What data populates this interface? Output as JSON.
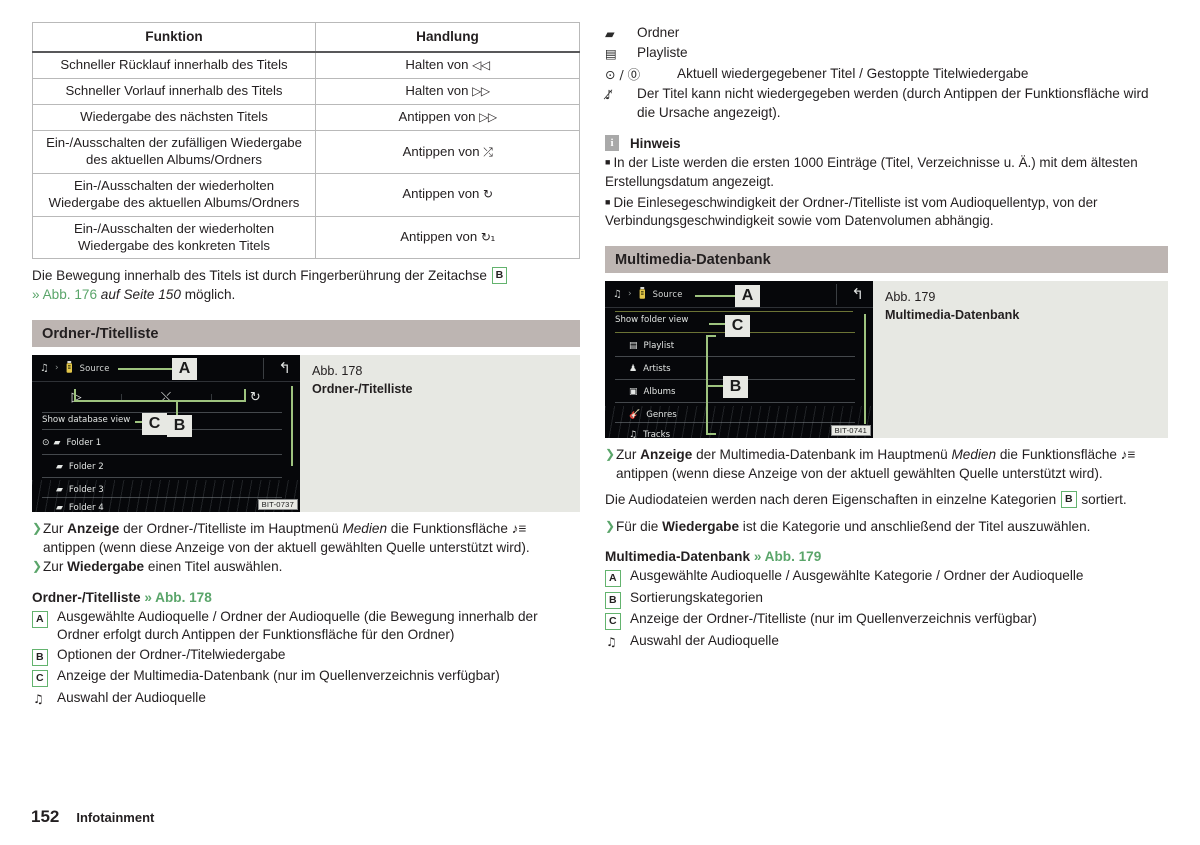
{
  "table": {
    "headers": [
      "Funktion",
      "Handlung"
    ],
    "rows": [
      {
        "function": "Schneller Rücklauf innerhalb des Titels",
        "action": "Halten von ",
        "icon": "◁◁"
      },
      {
        "function": "Schneller Vorlauf innerhalb des Titels",
        "action": "Halten von ",
        "icon": "▷▷"
      },
      {
        "function": "Wiedergabe des nächsten Titels",
        "action": "Antippen von ",
        "icon": "▷▷"
      },
      {
        "function": "Ein-/Ausschalten der zufälligen Wiedergabe des aktuellen Albums/Ordners",
        "action": "Antippen von ",
        "icon": "⤮"
      },
      {
        "function": "Ein-/Ausschalten der wiederholten Wiedergabe des aktuellen Albums/Ordners",
        "action": "Antippen von ",
        "icon": "↻"
      },
      {
        "function": "Ein-/Ausschalten der wiederholten Wiedergabe des konkreten Titels",
        "action": "Antippen von ",
        "icon": "↻₁"
      }
    ]
  },
  "intro_paragraph": {
    "line1": "Die Bewegung innerhalb des Titels ist durch Fingerberührung der Zeitachse ",
    "ref": "B",
    "link": "» Abb. 176",
    "italic": " auf Seite 150",
    "tail": " möglich."
  },
  "section_left": {
    "heading": "Ordner-/Titelliste",
    "figure": {
      "number": "Abb. 178",
      "title": "Ordner-/Titelliste",
      "bit_code": "BIT-0737",
      "screen": {
        "breadcrumb_note_icon": "♫",
        "breadcrumb_chevron": "›",
        "breadcrumb_source": "Source",
        "back_icon": "↰",
        "options": [
          "▷",
          "⤬",
          "↻"
        ],
        "db_link": "Show database view",
        "list": [
          {
            "playing": true,
            "icon": "folder",
            "label": "Folder 1"
          },
          {
            "playing": false,
            "icon": "folder",
            "label": "Folder 2"
          },
          {
            "playing": false,
            "icon": "folder",
            "label": "Folder 3"
          },
          {
            "playing": false,
            "icon": "folder",
            "label": "Folder 4"
          }
        ],
        "callouts": [
          "A",
          "C",
          "B"
        ]
      }
    },
    "steps": [
      {
        "parts": [
          "Zur ",
          "Anzeige",
          " der Ordner-/Titelliste im Hauptmenü ",
          "Medien",
          " die Funktionsfläche ♪≡ antippen (wenn diese Anzeige von der aktuell gewählten Quelle unterstützt wird)."
        ]
      },
      {
        "parts": [
          "Zur ",
          "Wiedergabe",
          " einen Titel auswählen.",
          "",
          ""
        ]
      }
    ],
    "legend_title": "Ordner-/Titelliste",
    "legend_link": "» Abb. 178",
    "legend": [
      {
        "key": "A",
        "type": "box",
        "text": "Ausgewählte Audioquelle / Ordner der Audioquelle (die Bewegung innerhalb der Ordner erfolgt durch Antippen der Funktionsfläche für den Ordner)"
      },
      {
        "key": "B",
        "type": "box",
        "text": "Optionen der Ordner-/Titelwiedergabe"
      },
      {
        "key": "C",
        "type": "box",
        "text": "Anzeige der Multimedia-Datenbank (nur im Quellenverzeichnis verfügbar)"
      },
      {
        "key": "♫",
        "type": "glyph",
        "text": "Auswahl der Audioquelle"
      }
    ]
  },
  "right_symbols": [
    {
      "symbol": "▰",
      "name": "folder-icon",
      "text": "Ordner"
    },
    {
      "symbol": "▤",
      "name": "playlist-icon",
      "text": "Playliste"
    },
    {
      "symbol": "⊙ / ⓪",
      "name": "play-pause-icon",
      "text": "Aktuell wiedergegebener Titel / Gestoppte Titelwiedergabe",
      "wide": true
    },
    {
      "symbol": "♪̸",
      "name": "note-blocked-icon",
      "text": "Der Titel kann nicht wiedergegeben werden (durch Antippen der Funktionsfläche wird die Ursache angezeigt)."
    }
  ],
  "note": {
    "icon_letter": "i",
    "title": "Hinweis",
    "items": [
      "In der Liste werden die ersten 1000 Einträge (Titel, Verzeichnisse u. Ä.) mit dem ältesten Erstellungsdatum angezeigt.",
      "Die Einlesegeschwindigkeit der Ordner-/Titelliste ist vom Audioquellentyp, von der Verbindungsgeschwindigkeit sowie vom Datenvolumen abhängig."
    ]
  },
  "section_right": {
    "heading": "Multimedia-Datenbank",
    "figure": {
      "number": "Abb. 179",
      "title": "Multimedia-Datenbank",
      "bit_code": "BIT-0741",
      "screen": {
        "breadcrumb_note_icon": "♫",
        "breadcrumb_chevron": "›",
        "breadcrumb_source": "Source",
        "back_icon": "↰",
        "folder_link": "Show folder view",
        "list": [
          {
            "icon": "playlist",
            "label": "Playlist"
          },
          {
            "icon": "artist",
            "label": "Artists"
          },
          {
            "icon": "album",
            "label": "Albums"
          },
          {
            "icon": "genre",
            "label": "Genres"
          },
          {
            "icon": "track",
            "label": "Tracks"
          }
        ],
        "callouts": [
          "A",
          "C",
          "B"
        ]
      }
    },
    "step1": {
      "parts": [
        "Zur ",
        "Anzeige",
        " der Multimedia-Datenbank im Hauptmenü ",
        "Medien",
        " die Funktionsfläche ♪≡ antippen (wenn diese Anzeige von der aktuell gewählten Quelle unterstützt wird)."
      ]
    },
    "sorted_text": {
      "pre": "Die Audiodateien werden nach deren Eigenschaften in einzelne Kategorien ",
      "ref": "B",
      "post": " sortiert."
    },
    "step2": {
      "parts": [
        "Für die ",
        "Wiedergabe",
        " ist die Kategorie und anschließend der Titel auszuwählen."
      ]
    },
    "legend_title": "Multimedia-Datenbank",
    "legend_link": "» Abb. 179",
    "legend": [
      {
        "key": "A",
        "type": "box",
        "text": "Ausgewählte Audioquelle / Ausgewählte Kategorie / Ordner der Audioquelle"
      },
      {
        "key": "B",
        "type": "box",
        "text": "Sortierungskategorien"
      },
      {
        "key": "C",
        "type": "box",
        "text": "Anzeige der Ordner-/Titelliste (nur im Quellenverzeichnis verfügbar)"
      },
      {
        "key": "♫",
        "type": "glyph",
        "text": "Auswahl der Audioquelle"
      }
    ]
  },
  "footer": {
    "page": "152",
    "chapter": "Infotainment"
  },
  "colors": {
    "accent_green": "#5aa56a",
    "callout_green": "#9ec37f",
    "section_bar": "#bdb5b2",
    "figure_bg": "#e7e8e3",
    "screen_bg": "#06070a",
    "text": "#231f20"
  }
}
